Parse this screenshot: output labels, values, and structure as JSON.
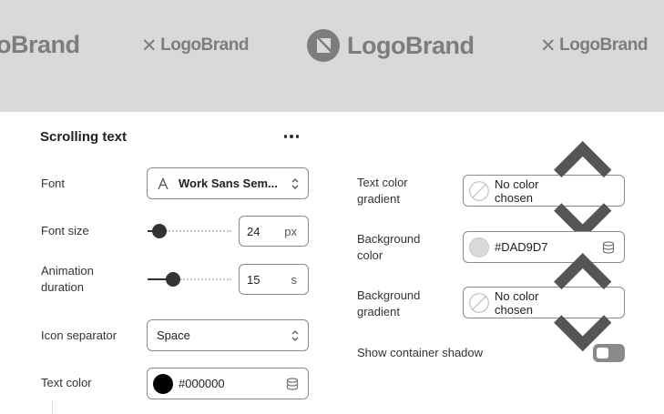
{
  "banner": {
    "background": "#DAD9D7",
    "logos": [
      {
        "text": "oBrand",
        "style": "large"
      },
      {
        "text": "LogoBrand",
        "style": "small-x"
      },
      {
        "text": "LogoBrand",
        "style": "large-mark"
      },
      {
        "text": "LogoBrand",
        "style": "small-x"
      }
    ]
  },
  "panel": {
    "title": "Scrolling text",
    "more_icon": "more-horizontal-icon"
  },
  "fields": {
    "font": {
      "label": "Font",
      "value": "Work Sans Sem...",
      "icon": "font-type-icon"
    },
    "font_size": {
      "label": "Font size",
      "value": "24",
      "unit": "px",
      "slider_fraction": 0.08
    },
    "animation_duration": {
      "label1": "Animation",
      "label2": "duration",
      "value": "15",
      "unit": "s",
      "slider_fraction": 0.3
    },
    "icon_separator": {
      "label": "Icon separator",
      "value": "Space"
    },
    "text_color": {
      "label": "Text color",
      "value": "#000000",
      "swatch": "#000000"
    },
    "text_color_gradient": {
      "label1": "Text color",
      "label2": "gradient",
      "value": "No color chosen"
    },
    "background_color": {
      "label1": "Background",
      "label2": "color",
      "value": "#DAD9D7",
      "swatch": "#DAD9D7"
    },
    "background_gradient": {
      "label1": "Background",
      "label2": "gradient",
      "value": "No color chosen"
    },
    "container_shadow": {
      "label": "Show container shadow",
      "enabled": false
    }
  }
}
